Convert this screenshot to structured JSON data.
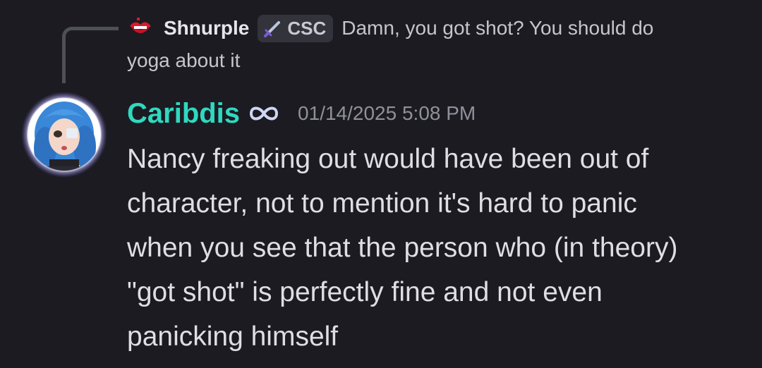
{
  "reply": {
    "avatar_icon": "red-lips-icon",
    "author": "Shnurple",
    "tag_icon": "sword-icon",
    "tag_label": "CSC",
    "text_line1": "Damn, you got shot? You should do",
    "text_line2": "yoga about it"
  },
  "message": {
    "avatar_icon": "avatar-blue-hair",
    "author": "Caribdis",
    "author_color": "#2fd9c0",
    "name_icon": "infinity-icon",
    "timestamp": "01/14/2025 5:08 PM",
    "lines": [
      "Nancy freaking out would have been out of",
      "character, not to mention it's hard to panic",
      "when you see that the person who (in theory)",
      "\"got shot\" is perfectly fine and not even",
      "panicking himself"
    ]
  }
}
